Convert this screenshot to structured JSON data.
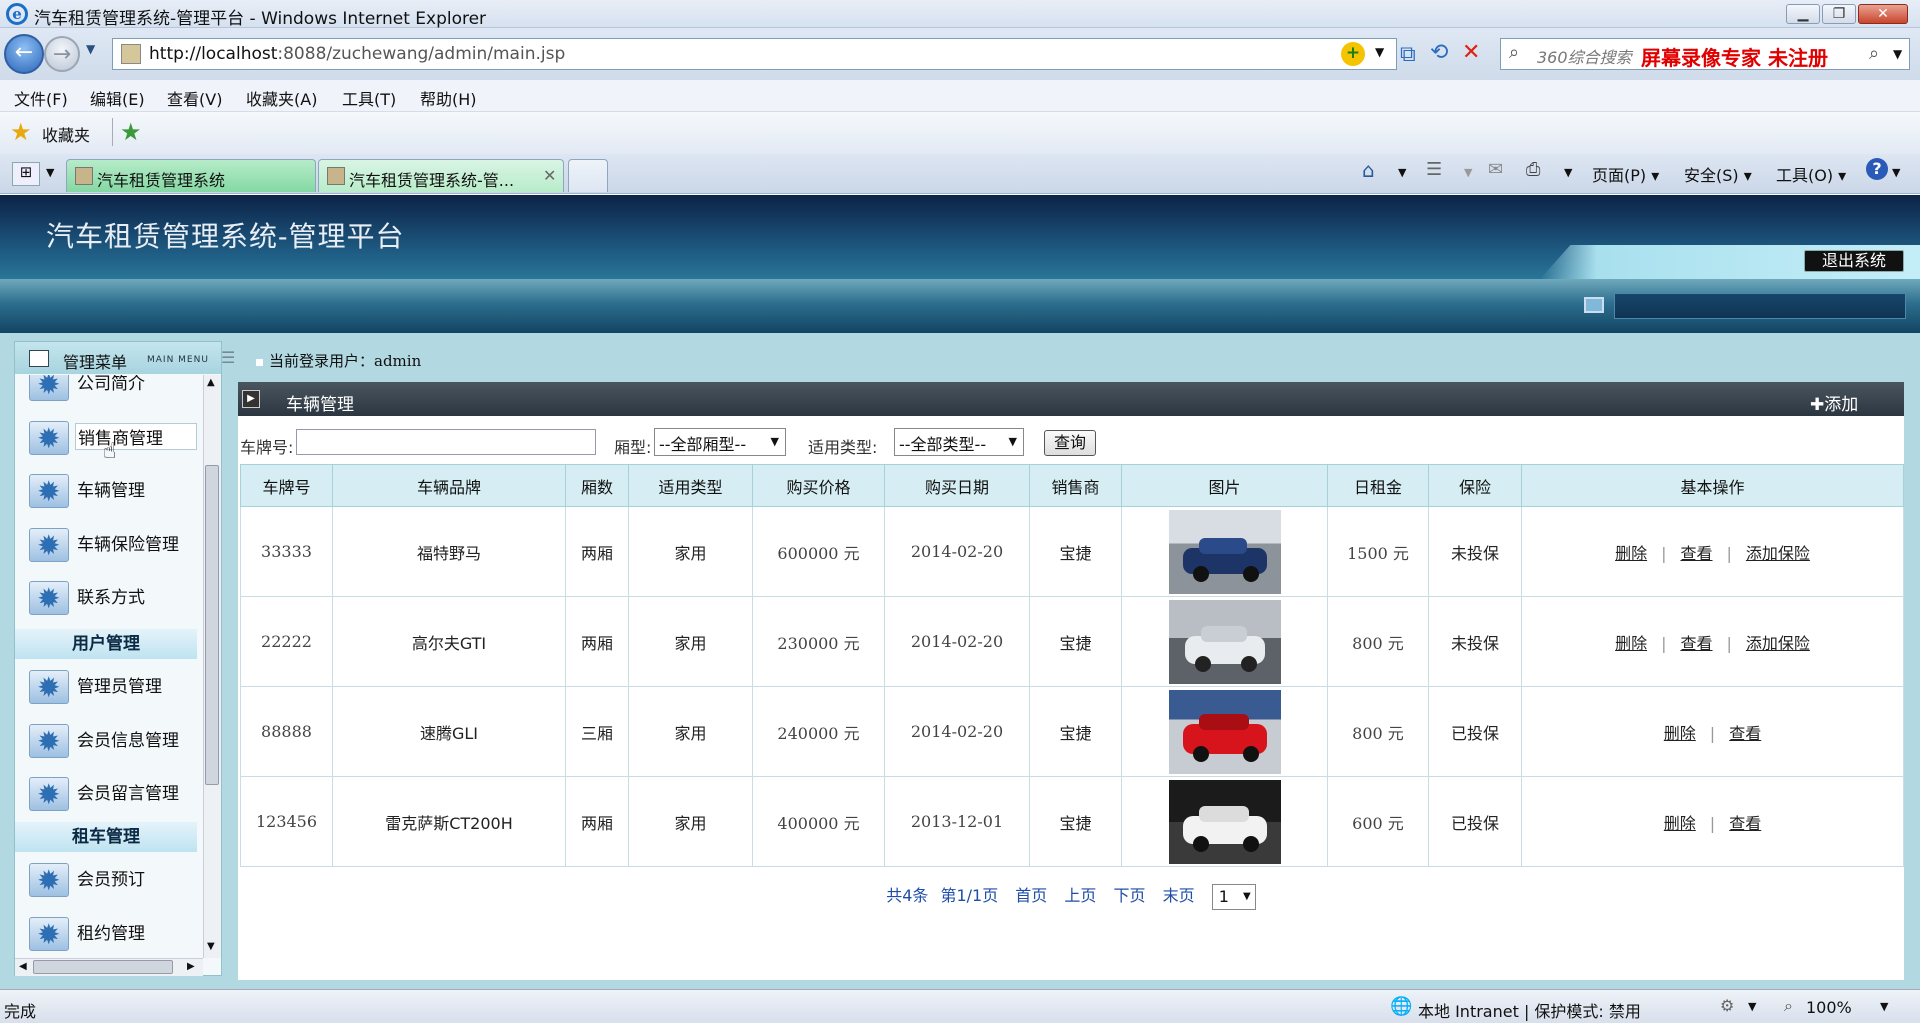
{
  "window": {
    "title": "汽车租赁管理系统-管理平台 - Windows Internet Explorer"
  },
  "address": {
    "url_host": "http://localhost",
    "url_rest": ":8088/zuchewang/admin/main.jsp"
  },
  "search": {
    "placeholder": "360综合搜索",
    "watermark": "屏幕录像专家  未注册"
  },
  "menu": [
    "文件(F)",
    "编辑(E)",
    "查看(V)",
    "收藏夹(A)",
    "工具(T)",
    "帮助(H)"
  ],
  "favorites": {
    "label": "收藏夹"
  },
  "tabs": [
    {
      "label": "汽车租赁管理系统"
    },
    {
      "label": "汽车租赁管理系统-管..."
    }
  ],
  "commandbar": {
    "page": "页面(P)",
    "safety": "安全(S)",
    "tools": "工具(O)"
  },
  "app": {
    "title": "汽车租赁管理系统-管理平台",
    "logout": "退出系统"
  },
  "sidebar": {
    "title": "管理菜单",
    "subtitle": "MAIN MENU",
    "items_top": [
      "公司简介",
      "销售商管理",
      "车辆管理",
      "车辆保险管理",
      "联系方式"
    ],
    "section_user": "用户管理",
    "items_user": [
      "管理员管理",
      "会员信息管理",
      "会员留言管理"
    ],
    "section_rent": "租车管理",
    "items_rent": [
      "会员预订",
      "租约管理"
    ]
  },
  "userbar": {
    "label": "当前登录用户：",
    "user": "admin"
  },
  "panel": {
    "title": "车辆管理",
    "add": "✚添加"
  },
  "filter": {
    "plate_label": "车牌号:",
    "box_label": "厢型:",
    "box_value": "--全部厢型--",
    "type_label": "适用类型:",
    "type_value": "--全部类型--",
    "query": "查询"
  },
  "table": {
    "headers": [
      "车牌号",
      "车辆品牌",
      "厢数",
      "适用类型",
      "购买价格",
      "购买日期",
      "销售商",
      "图片",
      "日租金",
      "保险",
      "基本操作"
    ],
    "rows": [
      {
        "plate": "33333",
        "brand": "福特野马",
        "boxes": "两厢",
        "type": "家用",
        "price": "600000 元",
        "date": "2014-02-20",
        "dealer": "宝捷",
        "rent": "1500 元",
        "ins": "未投保",
        "ops": [
          "删除",
          "查看",
          "添加保险"
        ]
      },
      {
        "plate": "22222",
        "brand": "高尔夫GTI",
        "boxes": "两厢",
        "type": "家用",
        "price": "230000 元",
        "date": "2014-02-20",
        "dealer": "宝捷",
        "rent": "800 元",
        "ins": "未投保",
        "ops": [
          "删除",
          "查看",
          "添加保险"
        ]
      },
      {
        "plate": "88888",
        "brand": "速腾GLI",
        "boxes": "三厢",
        "type": "家用",
        "price": "240000 元",
        "date": "2014-02-20",
        "dealer": "宝捷",
        "rent": "800 元",
        "ins": "已投保",
        "ops": [
          "删除",
          "查看"
        ]
      },
      {
        "plate": "123456",
        "brand": "雷克萨斯CT200H",
        "boxes": "两厢",
        "type": "家用",
        "price": "400000 元",
        "date": "2013-12-01",
        "dealer": "宝捷",
        "rent": "600 元",
        "ins": "已投保",
        "ops": [
          "删除",
          "查看"
        ]
      }
    ]
  },
  "pager": {
    "total": "共4条",
    "page": "第1/1页",
    "first": "首页",
    "prev": "上页",
    "next": "下页",
    "last": "末页",
    "current": "1"
  },
  "status": {
    "done": "完成",
    "zone": "本地 Intranet | 保护模式: 禁用",
    "zoom": "100%"
  },
  "colors": {
    "car1": "#1d3566",
    "car2": "#e9ecef",
    "car3": "#d7141b",
    "car4": "#f2f2f2"
  }
}
